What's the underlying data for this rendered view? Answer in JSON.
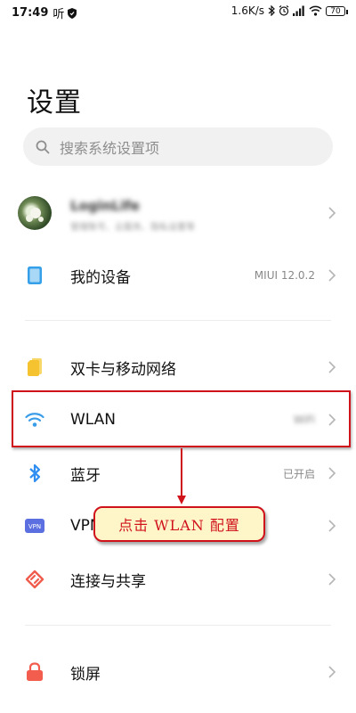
{
  "status_bar": {
    "time": "17:49",
    "listen_icon_text": "听",
    "network_speed": "1.6K/s",
    "battery": "70"
  },
  "page_title": "设置",
  "search": {
    "placeholder": "搜索系统设置项"
  },
  "account": {
    "name": "LoginLife",
    "subtitle": "管理账号、云服务、隐私设置等"
  },
  "rows": {
    "my_device": {
      "label": "我的设备",
      "value": "MIUI 12.0.2"
    },
    "sim_network": {
      "label": "双卡与移动网络"
    },
    "wlan": {
      "label": "WLAN",
      "value": "WiFi"
    },
    "bluetooth": {
      "label": "蓝牙",
      "value": "已开启"
    },
    "vpn": {
      "label": "VPN",
      "icon_text": "VPN"
    },
    "connection_sharing": {
      "label": "连接与共享"
    },
    "lock_screen": {
      "label": "锁屏"
    }
  },
  "annotation": {
    "callout_text": "点击 WLAN 配置"
  },
  "colors": {
    "accent_blue": "#3b9de8",
    "device_icon": "#35a0e9",
    "sim_icon": "#f5c230",
    "bluetooth_icon": "#2f8ef0",
    "vpn_icon": "#5b6fe0",
    "share_icon": "#ef5b4c",
    "lock_icon": "#f25d4e",
    "annotation_red": "#d0121b",
    "callout_bg": "#fef6c9"
  },
  "icons": {
    "listen": "listen-app-icon",
    "shield": "shield-icon",
    "bluetooth_status": "bluetooth-icon",
    "alarm": "alarm-icon",
    "signal": "signal-icon",
    "wifi_status": "wifi-icon",
    "search": "search-icon",
    "chevron": "chevron-right-icon"
  }
}
